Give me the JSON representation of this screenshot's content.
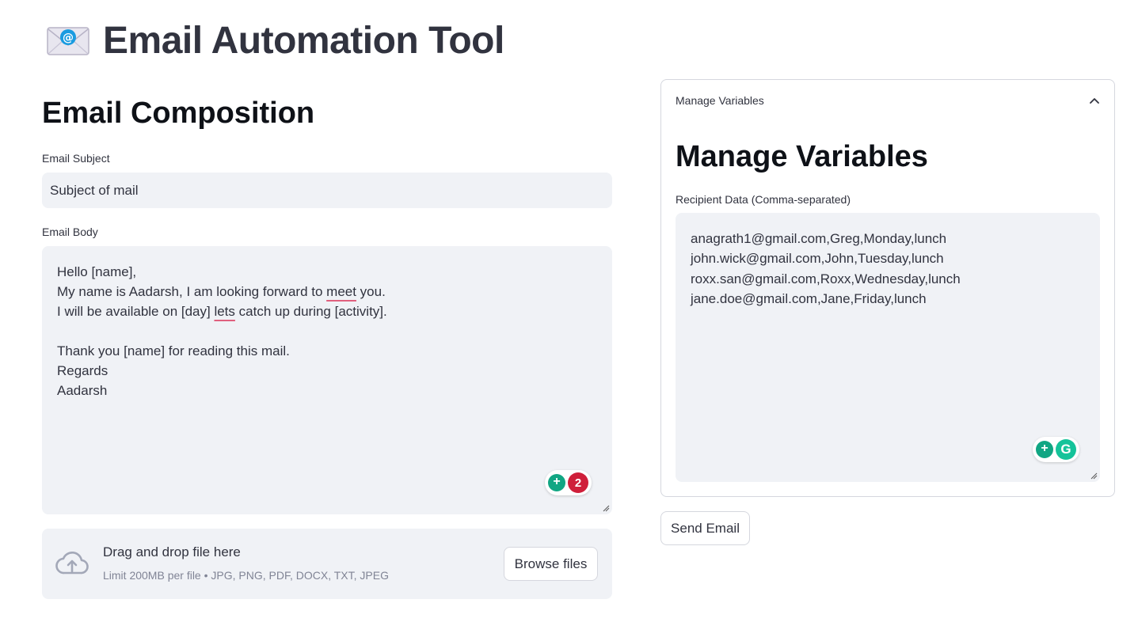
{
  "app": {
    "title": "Email Automation Tool",
    "title_icon": "envelope-at-icon"
  },
  "composition": {
    "heading": "Email Composition",
    "subject": {
      "label": "Email Subject",
      "value": "Subject of mail"
    },
    "body": {
      "label": "Email Body",
      "lines": [
        "Hello [name],",
        "My name is Aadarsh, I am looking forward to meet you.",
        "I will be available on [day] lets catch up during [activity].",
        "",
        "Thank you [name] for reading this mail.",
        "Regards",
        "Aadarsh"
      ],
      "line2_before": "My name is Aadarsh, I am looking forward to ",
      "line2_flag": "meet",
      "line2_after": " you.",
      "line3_before": "I will be available on [day] ",
      "line3_flag": "lets",
      "line3_after": " catch up during [activity].",
      "grammar_issue_count": "2"
    },
    "uploader": {
      "title": "Drag and drop file here",
      "limit": "Limit 200MB per file • JPG, PNG, PDF, DOCX, TXT, JPEG",
      "browse_label": "Browse files"
    }
  },
  "variables": {
    "expander_label": "Manage Variables",
    "heading": "Manage Variables",
    "recipients": {
      "label": "Recipient Data (Comma-separated)",
      "lines": [
        "anagrath1@gmail.com,Greg,Monday,lunch",
        "john.wick@gmail.com,John,Tuesday,lunch",
        "roxx.san@gmail.com,Roxx,Wednesday,lunch",
        "jane.doe@gmail.com,Jane,Friday,lunch"
      ]
    }
  },
  "actions": {
    "send_label": "Send Email"
  },
  "colors": {
    "input_bg": "#f0f2f6",
    "text": "#31333f",
    "grammarly_green": "#15c39a",
    "issue_red": "#cf1f3a"
  }
}
